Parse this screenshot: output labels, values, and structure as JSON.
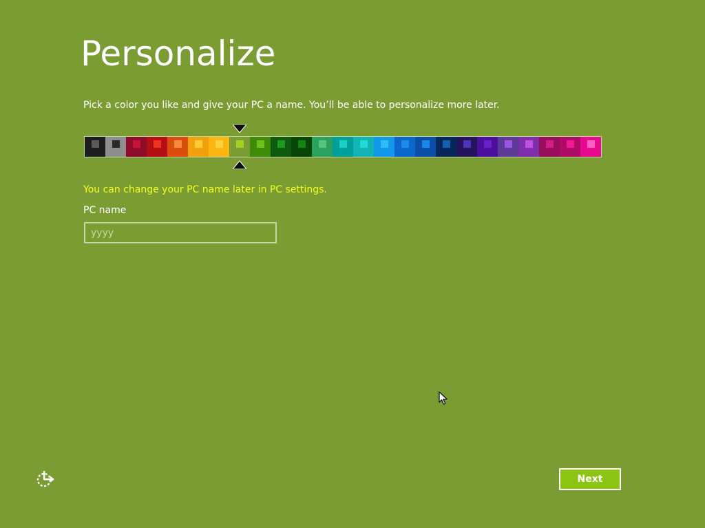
{
  "theme": {
    "background": "#7b9c32",
    "note_color": "#f2ff24",
    "button_fill": "#8cc414"
  },
  "header": {
    "title": "Personalize",
    "subtitle": "Pick a color you like and give your PC a name. You’ll be able to personalize more later."
  },
  "color_picker": {
    "selected_index": 7,
    "swatches": [
      {
        "bg": "#1d1d1d",
        "chip": "#5a5a5a"
      },
      {
        "bg": "#8e8e8e",
        "chip": "#2a2a2a"
      },
      {
        "bg": "#8e0c2a",
        "chip": "#c8123a"
      },
      {
        "bg": "#b40e16",
        "chip": "#f3321e"
      },
      {
        "bg": "#d94e0e",
        "chip": "#f58a3e"
      },
      {
        "bg": "#f0a10c",
        "chip": "#ffc836"
      },
      {
        "bg": "#fbb614",
        "chip": "#ffd33c"
      },
      {
        "bg": "#7b9c32",
        "chip": "#a6d020"
      },
      {
        "bg": "#3f8a08",
        "chip": "#6cc21a"
      },
      {
        "bg": "#0e5a0e",
        "chip": "#1c9a1c"
      },
      {
        "bg": "#064506",
        "chip": "#128612"
      },
      {
        "bg": "#2aa15f",
        "chip": "#56c47c"
      },
      {
        "bg": "#00a09a",
        "chip": "#18cfc6"
      },
      {
        "bg": "#12b4b4",
        "chip": "#22dad8"
      },
      {
        "bg": "#1197ec",
        "chip": "#2cbff6"
      },
      {
        "bg": "#0c66cc",
        "chip": "#1a8ee4"
      },
      {
        "bg": "#0a4ea8",
        "chip": "#1a86e8"
      },
      {
        "bg": "#07275a",
        "chip": "#1460b0"
      },
      {
        "bg": "#24145e",
        "chip": "#4a34b8"
      },
      {
        "bg": "#4c0e9c",
        "chip": "#6a20c8"
      },
      {
        "bg": "#5d3a98",
        "chip": "#9a56e0"
      },
      {
        "bg": "#7e2eaa",
        "chip": "#c050e0"
      },
      {
        "bg": "#980e5a",
        "chip": "#d01e86"
      },
      {
        "bg": "#ae0a66",
        "chip": "#f01a96"
      },
      {
        "bg": "#e80a8e",
        "chip": "#ff60c0"
      }
    ]
  },
  "form": {
    "note": "You can change your PC name later in PC settings.",
    "pc_name_label": "PC name",
    "pc_name_value": "",
    "pc_name_placeholder": "yyyy"
  },
  "footer": {
    "next_label": "Next",
    "ease_of_access_icon": "ease-of-access-icon"
  }
}
